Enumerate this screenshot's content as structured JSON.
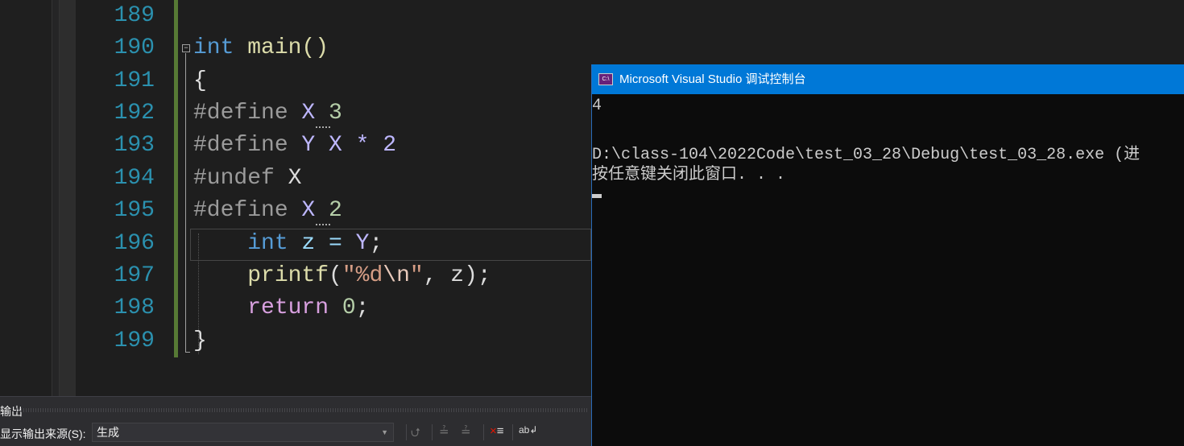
{
  "editor": {
    "line_numbers": [
      "189",
      "190",
      "191",
      "192",
      "193",
      "194",
      "195",
      "196",
      "197",
      "198",
      "199"
    ],
    "code": {
      "l190a": "int",
      "l190b": " main()",
      "l191": "{",
      "l192a": "#define ",
      "l192b": "X",
      "l192c": " 3",
      "l193a": "#define ",
      "l193b": "Y X * 2",
      "l194a": "#undef ",
      "l194b": "X",
      "l195a": "#define ",
      "l195b": "X",
      "l195c": " 2",
      "l196a": "    int",
      "l196b": " z = ",
      "l196c": "Y",
      "l196d": ";",
      "l197a": "    printf",
      "l197b": "(",
      "l197c": "\"%d",
      "l197d": "\\n",
      "l197e": "\"",
      "l197f": ", z);",
      "l198a": "    return",
      "l198b": " 0",
      "l198c": ";",
      "l199": "}"
    }
  },
  "output_panel": {
    "title": "输出",
    "source_label": "显示输出来源(S):",
    "source_value": "生成"
  },
  "console": {
    "title": "Microsoft Visual Studio 调试控制台",
    "icon_text": "C:\\",
    "lines": [
      "4",
      "",
      "D:\\class-104\\2022Code\\test_03_28\\Debug\\test_03_28.exe (进",
      "按任意键关闭此窗口. . ."
    ]
  },
  "colors": {
    "console_title": "#0078d7",
    "line_numbers": "#2b91af",
    "keyword": "#569cd6",
    "macro": "#beb7ff"
  }
}
